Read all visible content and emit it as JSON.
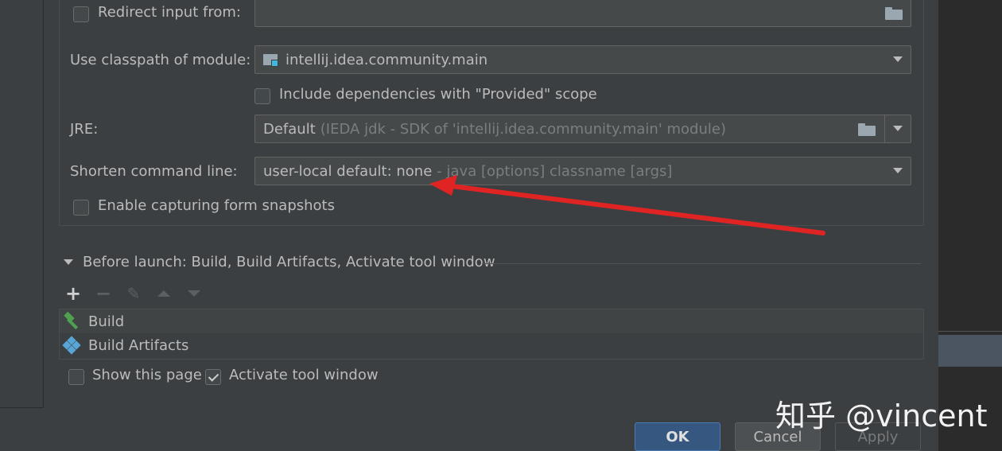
{
  "form": {
    "redirect_label": "Redirect input from:",
    "redirect_value": "",
    "module_label": "Use classpath of module:",
    "module_value": "intellij.idea.community.main",
    "include_deps_label": "Include dependencies with \"Provided\" scope",
    "jre_label": "JRE:",
    "jre_value": "Default",
    "jre_hint": "(IEDA jdk - SDK of 'intellij.idea.community.main' module)",
    "shorten_label": "Shorten command line:",
    "shorten_value": "user-local default: none",
    "shorten_hint": "- java [options] classname [args]",
    "snapshots_label": "Enable capturing form snapshots"
  },
  "before_launch": {
    "title": "Before launch: Build, Build Artifacts, Activate tool window",
    "tasks": [
      {
        "label": "Build",
        "icon": "hammer-icon"
      },
      {
        "label": "Build Artifacts",
        "icon": "artifacts-icon"
      }
    ],
    "show_page_label": "Show this page",
    "show_page_checked": false,
    "activate_label": "Activate tool window",
    "activate_checked": true
  },
  "buttons": {
    "ok": "OK",
    "cancel": "Cancel",
    "apply": "Apply"
  },
  "watermark": "知乎 @vincent",
  "colors": {
    "background": "#3c3f41",
    "field_bg": "#45494a",
    "ok_button": "#365880",
    "annotation_arrow": "#e02424"
  }
}
